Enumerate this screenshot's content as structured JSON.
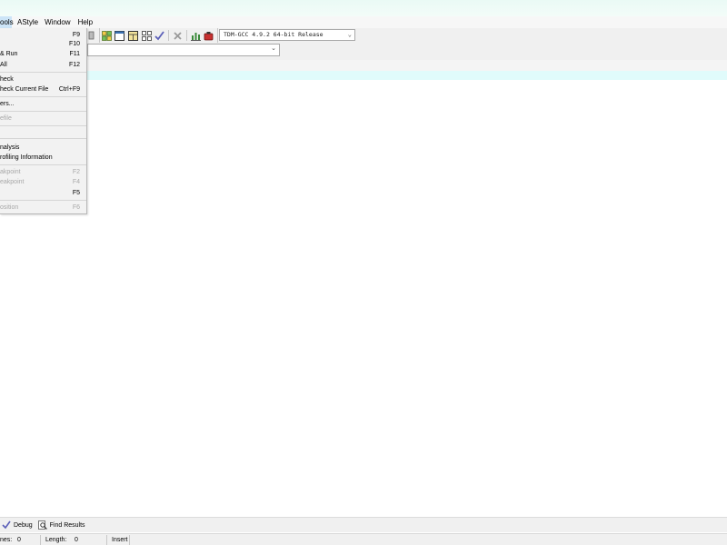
{
  "menubar": {
    "items": [
      "ools",
      "AStyle",
      "Window",
      "Help"
    ]
  },
  "compiler": {
    "selected": "TDM-GCC 4.9.2 64-bit Release"
  },
  "execute_menu": {
    "items": [
      {
        "label": "",
        "shortcut": "F9",
        "enabled": true
      },
      {
        "label": "",
        "shortcut": "F10",
        "enabled": true
      },
      {
        "label": "& Run",
        "shortcut": "F11",
        "enabled": true
      },
      {
        "label": "All",
        "shortcut": "F12",
        "enabled": true
      },
      {
        "label": "heck",
        "shortcut": "",
        "enabled": true
      },
      {
        "label": "heck Current File",
        "shortcut": "Ctrl+F9",
        "enabled": true
      },
      {
        "label": "ers...",
        "shortcut": "",
        "enabled": true
      },
      {
        "label": "efile",
        "shortcut": "",
        "enabled": false
      },
      {
        "label": "nalysis",
        "shortcut": "",
        "enabled": true
      },
      {
        "label": "rofiling Information",
        "shortcut": "",
        "enabled": true
      },
      {
        "label": "akpoint",
        "shortcut": "F2",
        "enabled": false
      },
      {
        "label": "eakpoint",
        "shortcut": "F4",
        "enabled": false
      },
      {
        "label": "",
        "shortcut": "F5",
        "enabled": true
      },
      {
        "label": "osition",
        "shortcut": "F6",
        "enabled": false
      }
    ]
  },
  "bottom_tabs": {
    "debug": "Debug",
    "find_results": "Find Results"
  },
  "statusbar": {
    "lines_label": "nes:",
    "lines_value": "0",
    "length_label": "Length:",
    "length_value": "0",
    "mode": "Insert"
  }
}
